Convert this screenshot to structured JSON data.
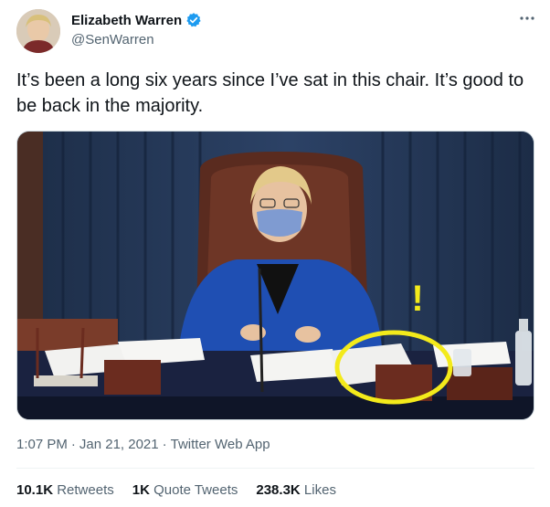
{
  "author": {
    "display_name": "Elizabeth Warren",
    "handle": "@SenWarren",
    "verified_color": "#1d9bf0"
  },
  "tweet": {
    "text": "It’s been a long six years since I’ve sat in this chair. It’s good to be back in the majority."
  },
  "media": {
    "highlight_color": "#f3ea1b",
    "exclamation": "!"
  },
  "meta": {
    "time": "1:07 PM",
    "separator1": "·",
    "date": "Jan 21, 2021",
    "separator2": "·",
    "app": "Twitter Web App"
  },
  "stats": {
    "retweets_count": "10.1K",
    "retweets_label": "Retweets",
    "quotes_count": "1K",
    "quotes_label": "Quote Tweets",
    "likes_count": "238.3K",
    "likes_label": "Likes"
  }
}
